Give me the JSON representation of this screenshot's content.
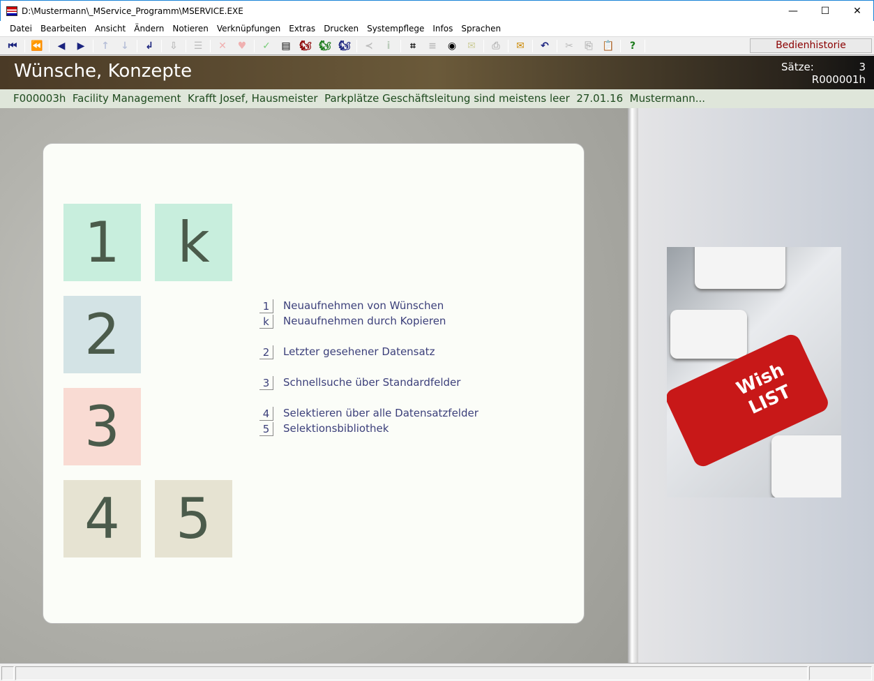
{
  "window": {
    "title": "D:\\Mustermann\\_MService_Programm\\MSERVICE.EXE",
    "minimize": "—",
    "maximize": "☐",
    "close": "✕"
  },
  "menu": [
    "Datei",
    "Bearbeiten",
    "Ansicht",
    "Ändern",
    "Notieren",
    "Verknüpfungen",
    "Extras",
    "Drucken",
    "Systempflege",
    "Infos",
    "Sprachen"
  ],
  "toolbar": {
    "icons": [
      {
        "name": "first-record-icon",
        "glyph": "⏮",
        "color": "#1a237e"
      },
      {
        "sep": true
      },
      {
        "name": "prev-page-icon",
        "glyph": "⏪",
        "color": "#1a237e"
      },
      {
        "sep": true
      },
      {
        "name": "prev-record-icon",
        "glyph": "◀",
        "color": "#1a237e"
      },
      {
        "name": "next-record-icon",
        "glyph": "▶",
        "color": "#1a237e"
      },
      {
        "sep": true
      },
      {
        "name": "arrow-up-icon",
        "glyph": "↑",
        "color": "#b8c0d8"
      },
      {
        "name": "arrow-down-icon",
        "glyph": "↓",
        "color": "#b8c0d8"
      },
      {
        "sep": true
      },
      {
        "name": "enter-icon",
        "glyph": "↲",
        "color": "#1a237e"
      },
      {
        "sep": true
      },
      {
        "name": "import-icon",
        "glyph": "⇩",
        "color": "#bbb"
      },
      {
        "sep": true
      },
      {
        "name": "tree-icon",
        "glyph": "☰",
        "color": "#bbb"
      },
      {
        "sep": true
      },
      {
        "name": "delete-icon",
        "glyph": "✕",
        "color": "#f0b0b0"
      },
      {
        "name": "heart-icon",
        "glyph": "♥",
        "color": "#f0b0b0"
      },
      {
        "sep": true
      },
      {
        "name": "check-icon",
        "glyph": "✓",
        "color": "#7c7"
      },
      {
        "name": "document-icon",
        "glyph": "▤",
        "color": "#000"
      },
      {
        "name": "squirrel-red-icon",
        "glyph": "🐿",
        "color": "#8b0000"
      },
      {
        "name": "squirrel-green-icon",
        "glyph": "🐿",
        "color": "#1a7a1a"
      },
      {
        "name": "squirrel-blue-icon",
        "glyph": "🐿",
        "color": "#1a237e"
      },
      {
        "sep": true
      },
      {
        "name": "branch-icon",
        "glyph": "≺",
        "color": "#bbb"
      },
      {
        "name": "info-icon",
        "glyph": "i",
        "color": "#bcb"
      },
      {
        "sep": true
      },
      {
        "name": "binoculars-icon",
        "glyph": "⌗",
        "color": "#000"
      },
      {
        "name": "list-icon",
        "glyph": "≡",
        "color": "#bbb"
      },
      {
        "name": "eye-icon",
        "glyph": "◉",
        "color": "#000"
      },
      {
        "name": "image-icon",
        "glyph": "✉",
        "color": "#cc9"
      },
      {
        "sep": true
      },
      {
        "name": "print-icon",
        "glyph": "⎙",
        "color": "#bbb"
      },
      {
        "sep": true
      },
      {
        "name": "mail-icon",
        "glyph": "✉",
        "color": "#c80"
      },
      {
        "sep": true
      },
      {
        "name": "undo-icon",
        "glyph": "↶",
        "color": "#1a237e"
      },
      {
        "sep": true
      },
      {
        "name": "cut-icon",
        "glyph": "✂",
        "color": "#bbb"
      },
      {
        "name": "copy-icon",
        "glyph": "⎘",
        "color": "#bbb"
      },
      {
        "name": "paste-icon",
        "glyph": "📋",
        "color": "#bbb"
      },
      {
        "sep": true
      },
      {
        "name": "help-icon",
        "glyph": "?",
        "color": "#1a7a1a"
      },
      {
        "sep": true
      }
    ],
    "history_label": "Bedienhistorie"
  },
  "header": {
    "title": "Wünsche, Konzepte",
    "records_label": "Sätze:",
    "records_count": "3",
    "record_id": "R000001h"
  },
  "info_line": "F000003h  Facility Management  Krafft Josef, Hausmeister  Parkplätze Geschäftsleitung sind meistens leer  27.01.16  Mustermann...",
  "tiles": [
    {
      "key": "1",
      "color": "#c8eedd"
    },
    {
      "key": "k",
      "color": "#c8eedd"
    },
    {
      "key": "2",
      "color": "#d3e3e5"
    },
    {
      "key": "3",
      "color": "#f9dbd3"
    },
    {
      "key": "4",
      "color": "#e6e3d2"
    },
    {
      "key": "5",
      "color": "#e6e3d2"
    }
  ],
  "actions": [
    {
      "key": "1",
      "label": "Neuaufnehmen von Wünschen"
    },
    {
      "key": "k",
      "label": "Neuaufnehmen durch Kopieren"
    },
    {
      "key": "2",
      "label": "Letzter gesehener Datensatz"
    },
    {
      "key": "3",
      "label": "Schnellsuche über Standardfelder"
    },
    {
      "key": "4",
      "label": "Selektieren über alle Datensatzfelder"
    },
    {
      "key": "5",
      "label": "Selektionsbibliothek"
    }
  ],
  "picture": {
    "text_line1": "Wish",
    "text_line2": "LIST"
  }
}
